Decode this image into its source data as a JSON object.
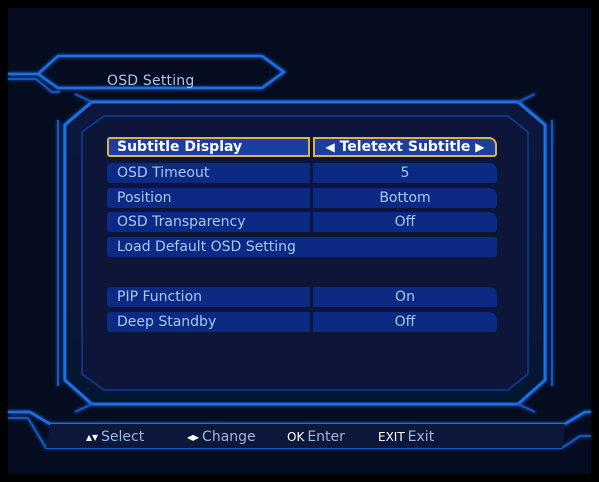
{
  "header": {
    "title": "OSD Setting"
  },
  "menu": {
    "items": [
      {
        "label": "Subtitle Display",
        "value": "Teletext Subtitle",
        "selected": true
      },
      {
        "label": "OSD Timeout",
        "value": "5"
      },
      {
        "label": "Position",
        "value": "Bottom"
      },
      {
        "label": "OSD Transparency",
        "value": "Off"
      },
      {
        "label": "Load Default OSD Setting"
      },
      {
        "label": "PIP Function",
        "value": "On"
      },
      {
        "label": "Deep Standby",
        "value": "Off"
      }
    ],
    "left_arrow_icon": "left-triangle-icon",
    "right_arrow_icon": "right-triangle-icon"
  },
  "footer": {
    "select_key": "▴▾",
    "select_label": "Select",
    "change_key": "◂▸",
    "change_label": "Change",
    "enter_key": "OK",
    "enter_label": "Enter",
    "exit_key": "EXIT",
    "exit_label": "Exit"
  },
  "colors": {
    "background": "#050c1f",
    "frame_glow": "#1e6fe6",
    "row_fill": "#0b2a83",
    "row_text": "#a8c9f3",
    "selected_border": "#d9b24d"
  }
}
